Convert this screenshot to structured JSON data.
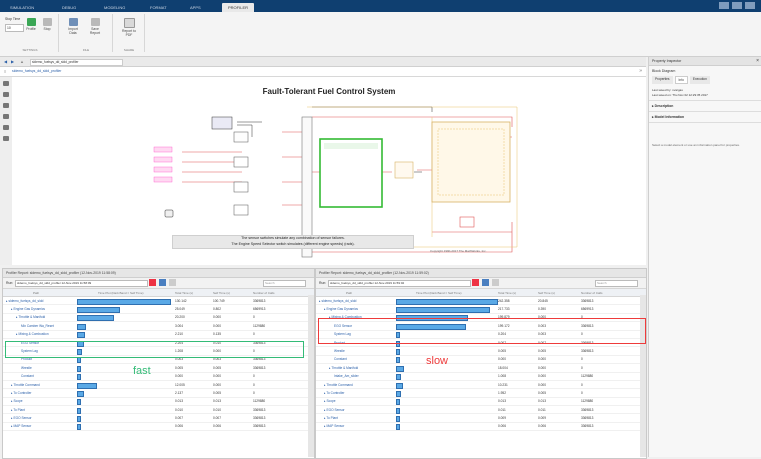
{
  "tabs": [
    "SIMULATION",
    "DEBUG",
    "MODELING",
    "FORMAT",
    "APPS",
    "PROFILER"
  ],
  "ribbon": {
    "stop_time_label": "Stop Time",
    "stop_time_value": "10",
    "buttons": [
      "Profile",
      "Stop",
      "Import Data",
      "Save Report",
      "Report to PDF"
    ],
    "groups": [
      "SETTINGS",
      "FILE",
      "SHARE"
    ]
  },
  "address": "sldemo_fuelsys_dd_sldd_profiler",
  "breadcrumb": "sldemo_fuelsys_dd_sldd_profiler",
  "diagram": {
    "title": "Fault-Tolerant Fuel Control System",
    "note_line1": "The sensor switches simulate any combination of sensor failures.",
    "note_line2": "The Engine Speed Selector switch simulates (different engine speeds) (rads).",
    "copyright": "Copyright 1990-2017 The MathWorks, Inc.",
    "sensor_labels": [
      "Throttle Sensor",
      "Speed Sensor",
      "EGO Sensor",
      "MAP Sensor"
    ],
    "left_labels": [
      "Throttle",
      "Speed",
      "EGO",
      "MAP"
    ],
    "block_texts": [
      "engine gas dynamics",
      "fuel rate control",
      "Dashboard",
      "To Plant"
    ]
  },
  "right_panel": {
    "header": "Property Inspector",
    "subtitle": "Block Diagram",
    "tabs": [
      "Properties",
      "Info",
      "Execution"
    ],
    "info_lines": [
      "Last saved by: nvargas",
      "Last saved on: Thu Nov 02 12:29:35 2017"
    ],
    "sections": [
      "Description",
      "Model Information"
    ],
    "hint": "Select a model element or use an information panel for properties."
  },
  "left_pane": {
    "title": "Profiler Report: sldemo_fuelsys_dd_sldd_profiler (12-Nov-2019 11:58:09)",
    "run_label": "Run:",
    "run_value": "sldemo_fuelsys_dd_sldd_profiler 12-Nov-2019 11:58:09",
    "search_placeholder": "Search",
    "columns": [
      "Path",
      "Time Plot (Dark Band = Self Time)",
      "Total Time (s)",
      "Self Time (s)",
      "Number of Calls"
    ],
    "rows": [
      {
        "name": "sldemo_fuelsys_dd_sldd",
        "total": "130.142",
        "self": "100.749",
        "calls": "3369813",
        "bar": 1.0,
        "indent": 0
      },
      {
        "name": "Engine Gas Dynamics",
        "total": "25.049",
        "self": "0.802",
        "calls": "6569913",
        "bar": 0.45,
        "indent": 1
      },
      {
        "name": "Throttle & Manifold",
        "total": "20.200",
        "self": "0.000",
        "calls": "0",
        "bar": 0.38,
        "indent": 2
      },
      {
        "name": "Mix Camber Wa_Reset",
        "total": "3.004",
        "self": "0.000",
        "calls": "1129880",
        "bar": 0.08,
        "indent": 3
      },
      {
        "name": "Mixing & Combustion",
        "total": "2.210",
        "self": "0.135",
        "calls": "0",
        "bar": 0.06,
        "indent": 2
      },
      {
        "name": "EGO Sensor",
        "total": "2.204",
        "self": "0.010",
        "calls": "3369813",
        "bar": 0.05,
        "indent": 3
      },
      {
        "name": "System Lag",
        "total": "1.208",
        "self": "0.000",
        "calls": "0",
        "bar": 0.03,
        "indent": 3
      },
      {
        "name": "Product",
        "total": "0.003",
        "self": "0.003",
        "calls": "3369813",
        "bar": 0.02,
        "indent": 3
      },
      {
        "name": "Wrestle",
        "total": "0.005",
        "self": "0.005",
        "calls": "3369813",
        "bar": 0.02,
        "indent": 3
      },
      {
        "name": "Constant",
        "total": "0.000",
        "self": "0.000",
        "calls": "0",
        "bar": 0.01,
        "indent": 3
      },
      {
        "name": "Throttle Command",
        "total": "12.005",
        "self": "0.000",
        "calls": "0",
        "bar": 0.2,
        "indent": 1
      },
      {
        "name": "To Controller",
        "total": "2.137",
        "self": "0.005",
        "calls": "0",
        "bar": 0.05,
        "indent": 1
      },
      {
        "name": "Scope",
        "total": "0.013",
        "self": "0.013",
        "calls": "1129880",
        "bar": 0.02,
        "indent": 1
      },
      {
        "name": "To Plant",
        "total": "0.010",
        "self": "0.010",
        "calls": "3369813",
        "bar": 0.02,
        "indent": 1
      },
      {
        "name": "EGO Sensor",
        "total": "0.007",
        "self": "0.007",
        "calls": "3369813",
        "bar": 0.02,
        "indent": 1
      },
      {
        "name": "MAP Sensor",
        "total": "0.006",
        "self": "0.006",
        "calls": "3369813",
        "bar": 0.02,
        "indent": 1
      }
    ],
    "annotation": "fast"
  },
  "right_pane": {
    "title": "Profiler Report: sldemo_fuelsys_dd_sldd_profiler (12-Nov-2019 11:59:02)",
    "run_label": "Run:",
    "run_value": "sldemo_fuelsys_dd_sldd_profiler 12-Nov-2019 11:59:02",
    "search_placeholder": "Search",
    "columns": [
      "Path",
      "Time Plot (Dark Band = Self Time)",
      "Total Time (s)",
      "Self Time (s)",
      "Number of Calls"
    ],
    "rows": [
      {
        "name": "sldemo_fuelsys_dd_sldd",
        "total": "242.358",
        "self": "20.845",
        "calls": "3369813",
        "bar": 1.0,
        "indent": 0
      },
      {
        "name": "Engine Gas Dynamics",
        "total": "217.733",
        "self": "0.390",
        "calls": "6569913",
        "bar": 0.92,
        "indent": 1
      },
      {
        "name": "Mixing & Combustion",
        "total": "199.879",
        "self": "0.000",
        "calls": "0",
        "bar": 0.7,
        "indent": 2
      },
      {
        "name": "EGO Sensor",
        "total": "199.172",
        "self": "0.003",
        "calls": "3369813",
        "bar": 0.68,
        "indent": 3
      },
      {
        "name": "System Lag",
        "total": "0.204",
        "self": "0.003",
        "calls": "0",
        "bar": 0.02,
        "indent": 3
      },
      {
        "name": "Product",
        "total": "0.007",
        "self": "0.007",
        "calls": "3369813",
        "bar": 0.02,
        "indent": 3
      },
      {
        "name": "Wrestle",
        "total": "0.005",
        "self": "0.005",
        "calls": "3369813",
        "bar": 0.02,
        "indent": 3
      },
      {
        "name": "Constant",
        "total": "0.000",
        "self": "0.000",
        "calls": "0",
        "bar": 0.01,
        "indent": 3
      },
      {
        "name": "Throttle & Manifold",
        "total": "18.004",
        "self": "0.000",
        "calls": "0",
        "bar": 0.06,
        "indent": 2
      },
      {
        "name": "Intake_Am_slider",
        "total": "1.008",
        "self": "0.000",
        "calls": "1129880",
        "bar": 0.03,
        "indent": 3
      },
      {
        "name": "Throttle Command",
        "total": "10.231",
        "self": "0.000",
        "calls": "0",
        "bar": 0.05,
        "indent": 1
      },
      {
        "name": "To Controller",
        "total": "1.952",
        "self": "0.005",
        "calls": "0",
        "bar": 0.03,
        "indent": 1
      },
      {
        "name": "Scope",
        "total": "0.013",
        "self": "0.013",
        "calls": "1129880",
        "bar": 0.02,
        "indent": 1
      },
      {
        "name": "EGO Sensor",
        "total": "0.011",
        "self": "0.011",
        "calls": "3369813",
        "bar": 0.02,
        "indent": 1
      },
      {
        "name": "To Plant",
        "total": "0.009",
        "self": "0.009",
        "calls": "3369813",
        "bar": 0.02,
        "indent": 1
      },
      {
        "name": "MAP Sensor",
        "total": "0.006",
        "self": "0.006",
        "calls": "3369813",
        "bar": 0.02,
        "indent": 1
      }
    ],
    "annotation": "slow"
  },
  "colors": {
    "accent": "#0f3f70",
    "green_highlight": "#33bb77",
    "red_highlight": "#ee3b3b",
    "bar": "#5aa9e6"
  }
}
